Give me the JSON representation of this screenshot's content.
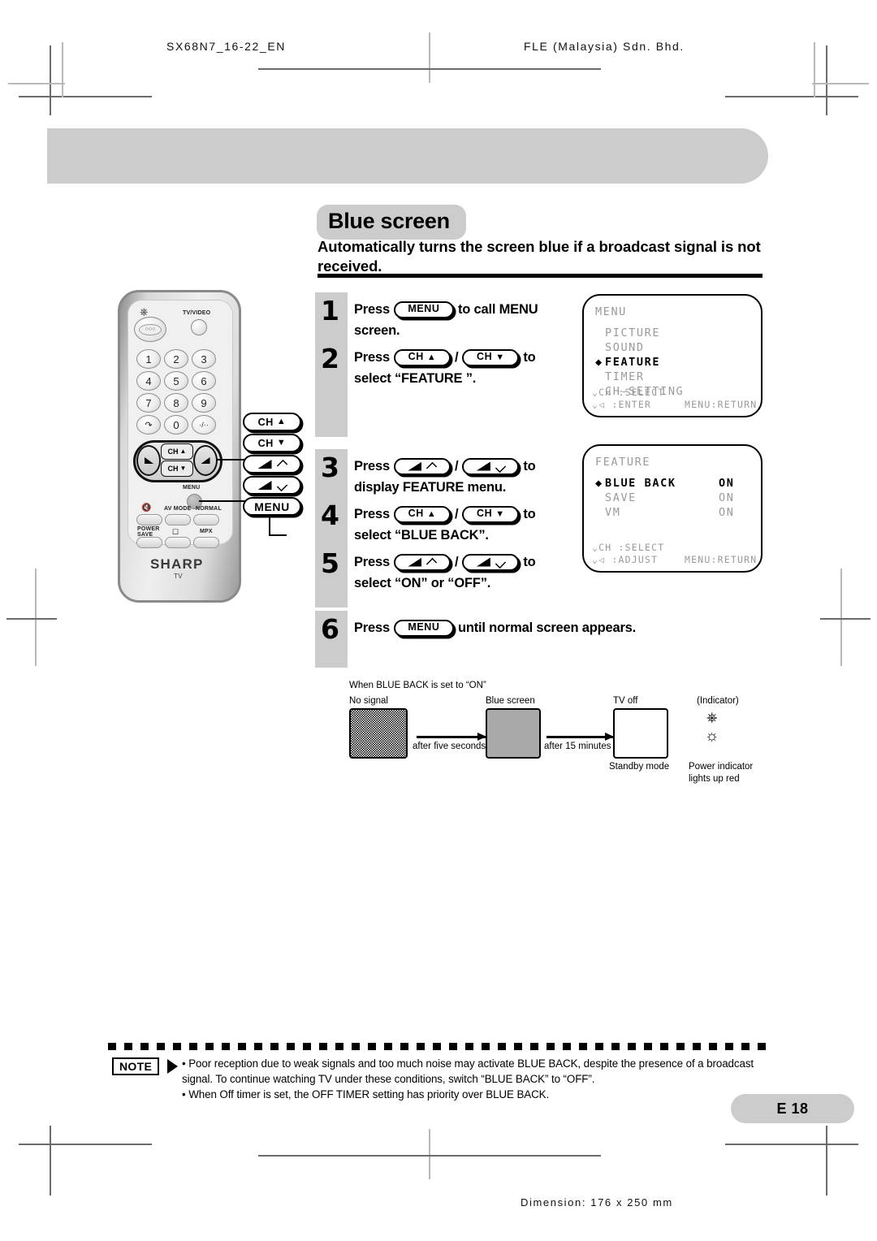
{
  "header": {
    "left_code": "SX68N7_16-22_EN",
    "right_company": "FLE (Malaysia) Sdn. Bhd."
  },
  "section": {
    "title": "Blue screen",
    "subtitle": "Automatically turns the screen blue if a broadcast signal is not received."
  },
  "steps": [
    {
      "number": "1",
      "line1_pre": "Press",
      "key1": "MENU",
      "line1_post": "to call MENU",
      "line2": "screen."
    },
    {
      "number": "2",
      "line1_pre": "Press",
      "key1": "CH",
      "sep": "/",
      "key2": "CH",
      "line1_post": "to",
      "line2": "select “FEATURE ”."
    },
    {
      "number": "3",
      "line1_pre": "Press",
      "sep": "/",
      "line1_post": "to",
      "line2": "display FEATURE menu."
    },
    {
      "number": "4",
      "line1_pre": "Press",
      "key1": "CH",
      "sep": "/",
      "key2": "CH",
      "line1_post": "to",
      "line2": "select “BLUE BACK”."
    },
    {
      "number": "5",
      "line1_pre": "Press",
      "sep": "/",
      "line1_post": "to",
      "line2": "select “ON” or “OFF”."
    },
    {
      "number": "6",
      "line1_pre": "Press",
      "key1": "MENU",
      "line1_post": "until normal screen appears."
    }
  ],
  "osd_menu": {
    "title": "MENU",
    "items": [
      {
        "label": "PICTURE",
        "selected": false
      },
      {
        "label": "SOUND",
        "selected": false
      },
      {
        "label": "FEATURE",
        "selected": true
      },
      {
        "label": "TIMER",
        "selected": false
      },
      {
        "label": "CH-SETTING",
        "selected": false
      }
    ],
    "hint1": "CH  :SELECT",
    "hint2": "◁ :ENTER",
    "hint3": "MENU:RETURN",
    "cursor": "◆"
  },
  "osd_feature": {
    "title": "FEATURE",
    "rows": [
      {
        "label": "BLUE BACK",
        "value": "ON",
        "selected": true
      },
      {
        "label": "SAVE",
        "value": "ON",
        "selected": false
      },
      {
        "label": "VM",
        "value": "ON",
        "selected": false
      }
    ],
    "hint1": "CH  :SELECT",
    "hint2": "◁ :ADJUST",
    "hint3": "MENU:RETURN",
    "cursor": "◆"
  },
  "diagram": {
    "caption": "When BLUE BACK is set to “ON”",
    "stage1_label": "No signal",
    "stage2_label": "Blue screen",
    "stage3_label": "TV off",
    "indicator_label": "(Indicator)",
    "arrow1_label": "after five seconds",
    "arrow2_label": "after 15 minutes",
    "standby_label": "Standby mode",
    "indicator_line1": "Power indicator",
    "indicator_line2": "lights up red"
  },
  "note": {
    "badge": "NOTE",
    "bullets": [
      "Poor reception due to weak signals and too much noise may activate BLUE BACK, despite the presence of a broadcast signal. To continue watching TV under these conditions, switch “BLUE BACK” to “OFF”.",
      "When Off timer is set, the OFF TIMER setting has priority over BLUE BACK."
    ]
  },
  "page_number": "E 18",
  "footer": "Dimension: 176 x 250 mm",
  "remote": {
    "tv_video_label": "TV/VIDEO",
    "menu_label": "MENU",
    "keys": [
      "1",
      "2",
      "3",
      "4",
      "5",
      "6",
      "7",
      "8",
      "9",
      "↺",
      "0",
      "·/··"
    ],
    "ch_up": "CH",
    "ch_down": "CH",
    "func_labels": [
      "AV MODE",
      "NORMAL",
      "POWER SAVE",
      "MPX"
    ],
    "brand": "SHARP",
    "brand_sub": "TV"
  },
  "callouts": {
    "ch_up": "CH",
    "ch_down": "CH",
    "menu": "MENU"
  }
}
